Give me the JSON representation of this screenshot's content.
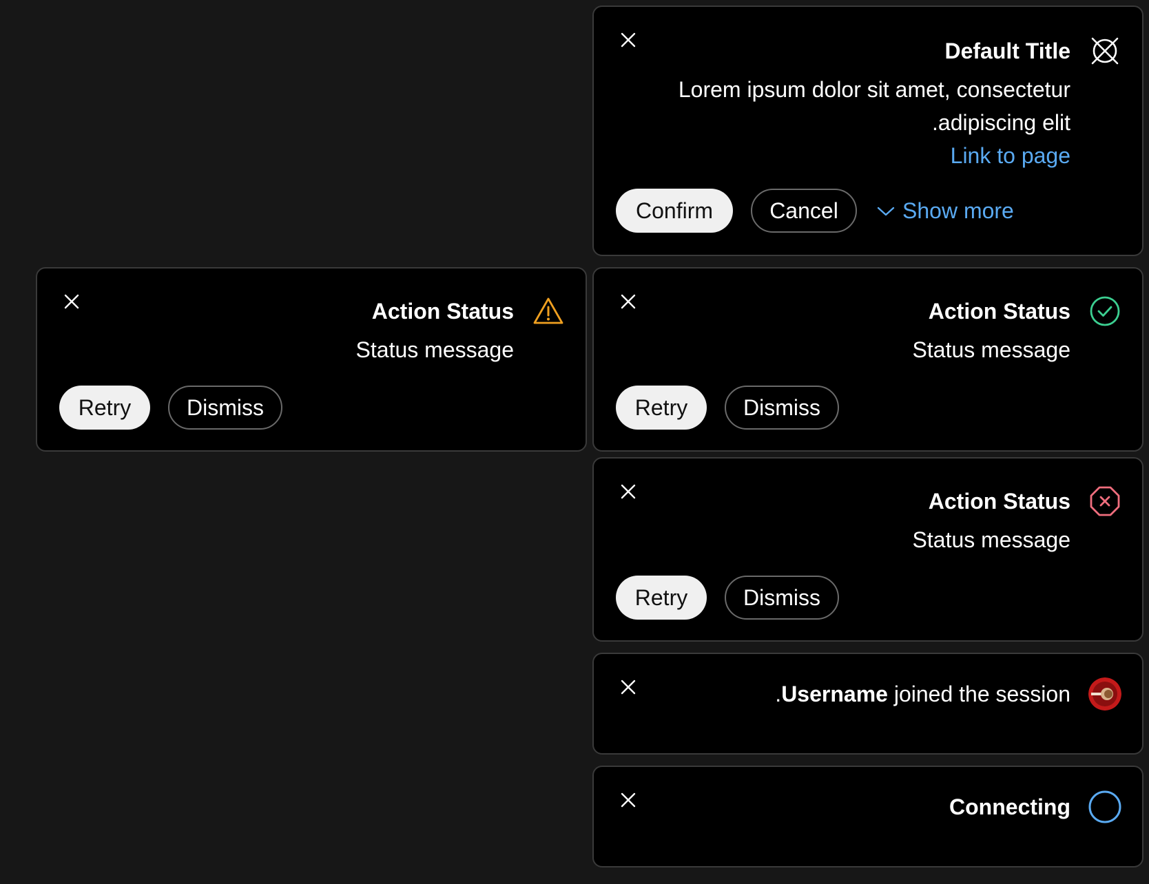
{
  "colors": {
    "background": "#171717",
    "toast_bg": "#000000",
    "border": "#3a3a3a",
    "link": "#5aaaf2",
    "warning": "#f0a020",
    "success": "#3ccf91",
    "error": "#f06e7e",
    "progress": "#5aaaf2"
  },
  "default_toast": {
    "title": "Default Title",
    "message_line1": "Lorem ipsum dolor sit amet, consectetur",
    "message_line2": ".adipiscing elit",
    "link": "Link to page",
    "confirm": "Confirm",
    "cancel": "Cancel",
    "show_more": "Show more",
    "icon": "crossed-circle-icon"
  },
  "warning_toast": {
    "title": "Action Status",
    "message": "Status message",
    "retry": "Retry",
    "dismiss": "Dismiss",
    "icon": "warning-icon"
  },
  "success_toast": {
    "title": "Action Status",
    "message": "Status message",
    "retry": "Retry",
    "dismiss": "Dismiss",
    "icon": "check-circle-icon"
  },
  "error_toast": {
    "title": "Action Status",
    "message": "Status message",
    "retry": "Retry",
    "dismiss": "Dismiss",
    "icon": "error-octagon-icon"
  },
  "user_toast": {
    "prefix": ".",
    "username": "Username",
    "text": " joined the session",
    "icon": "user-avatar"
  },
  "connecting_toast": {
    "title": "Connecting",
    "icon": "spinner-circle-icon"
  }
}
